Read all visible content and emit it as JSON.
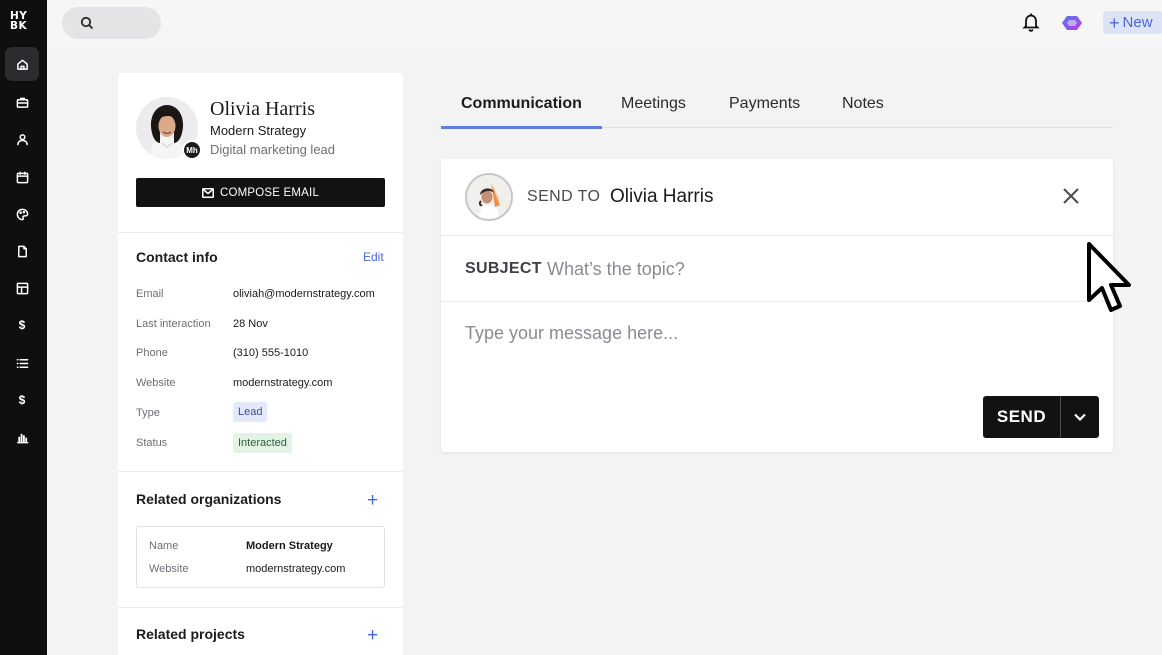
{
  "app": {
    "logo_line1": "HY",
    "logo_line2": "BK"
  },
  "leftnav": {
    "items": [
      {
        "icon": "home-icon",
        "active": true
      },
      {
        "icon": "briefcase-icon"
      },
      {
        "icon": "user-icon"
      },
      {
        "icon": "calendar-icon"
      },
      {
        "icon": "palette-icon"
      },
      {
        "icon": "file-icon"
      },
      {
        "icon": "layout-icon"
      },
      {
        "icon": "dollar-icon"
      },
      {
        "icon": "list-icon"
      },
      {
        "icon": "dollar-icon"
      },
      {
        "icon": "bar-chart-icon"
      }
    ]
  },
  "topbar": {
    "search_placeholder": "",
    "new_label": "New",
    "new_plus": "+"
  },
  "profile": {
    "name": "Olivia Harris",
    "company": "Modern Strategy",
    "role": "Digital marketing lead",
    "badge": "Mh",
    "compose_label": "COMPOSE EMAIL",
    "contact_info": {
      "title": "Contact info",
      "edit_label": "Edit",
      "rows": [
        {
          "label": "Email",
          "value": "oliviah@modernstrategy.com"
        },
        {
          "label": "Last interaction",
          "value": "28 Nov"
        },
        {
          "label": "Phone",
          "value": "(310) 555-1010"
        },
        {
          "label": "Website",
          "value": "modernstrategy.com"
        },
        {
          "label": "Type",
          "value": "Lead"
        },
        {
          "label": "Status",
          "value": "Interacted"
        }
      ]
    },
    "related_organizations": {
      "title": "Related organizations",
      "add_label": "+",
      "name_label": "Name",
      "name_value": "Modern Strategy",
      "website_label": "Website",
      "website_value": "modernstrategy.com"
    },
    "related_projects": {
      "title": "Related projects",
      "add_label": "+"
    }
  },
  "tabs": [
    {
      "label": "Communication",
      "active": true
    },
    {
      "label": "Meetings"
    },
    {
      "label": "Payments"
    },
    {
      "label": "Notes"
    }
  ],
  "composer": {
    "send_to_label": "SEND TO",
    "recipient": "Olivia Harris",
    "subject_label": "SUBJECT",
    "subject_placeholder": "What’s the topic?",
    "message_placeholder": "Type your message here...",
    "send_label": "SEND"
  },
  "colors": {
    "accent": "#4a66d6",
    "tab_underline": "#5f7ee0",
    "nav_bg": "#0f0f10",
    "button_dark": "#121214"
  }
}
